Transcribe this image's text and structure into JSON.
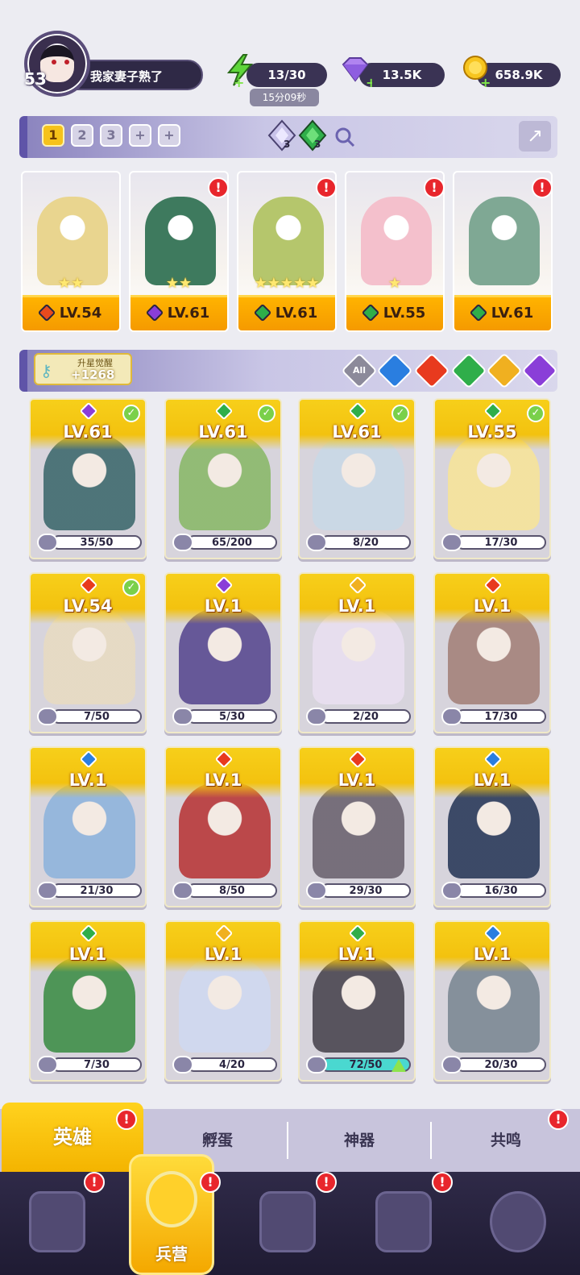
{
  "player": {
    "level": "53",
    "name": "我家妻子熟了"
  },
  "resources": {
    "energy": "13/30",
    "energy_timer": "15分09秒",
    "gems": "13.5K",
    "gold": "658.9K"
  },
  "team": {
    "tabs": [
      "1",
      "2",
      "3",
      "+",
      "+"
    ],
    "active_tab": "1",
    "counts": [
      "3",
      "3"
    ]
  },
  "team_cards": [
    {
      "level": "LV.54",
      "stars": "★★",
      "element": "fire",
      "color": "#e84a1e",
      "alert": false
    },
    {
      "level": "LV.61",
      "stars": "★★",
      "element": "dark",
      "color": "#8a3ed8",
      "alert": true
    },
    {
      "level": "LV.61",
      "stars": "★★★★★",
      "element": "nature",
      "color": "#2fae4a",
      "alert": true
    },
    {
      "level": "LV.55",
      "stars": "★",
      "element": "nature",
      "color": "#2fae4a",
      "alert": true
    },
    {
      "level": "LV.61",
      "stars": "",
      "element": "nature",
      "color": "#2fae4a",
      "alert": true
    }
  ],
  "awaken": {
    "title": "升星觉醒",
    "value": "+1268"
  },
  "filters": [
    {
      "label": "All",
      "color": "#8c8a9a"
    },
    {
      "label": "",
      "color": "#2a7ee0"
    },
    {
      "label": "",
      "color": "#e83a1e"
    },
    {
      "label": "",
      "color": "#2fae4a"
    },
    {
      "label": "",
      "color": "#f0b020"
    },
    {
      "label": "",
      "color": "#8a3ed8"
    }
  ],
  "heroes": [
    {
      "level": "LV.61",
      "progress": "35/50",
      "element_color": "#8a3ed8",
      "check": true
    },
    {
      "level": "LV.61",
      "progress": "65/200",
      "element_color": "#2fae4a",
      "check": true
    },
    {
      "level": "LV.61",
      "progress": "8/20",
      "element_color": "#2fae4a",
      "check": true
    },
    {
      "level": "LV.55",
      "progress": "17/30",
      "element_color": "#2fae4a",
      "check": true
    },
    {
      "level": "LV.54",
      "progress": "7/50",
      "element_color": "#e83a1e",
      "check": true
    },
    {
      "level": "LV.1",
      "progress": "5/30",
      "element_color": "#8a3ed8",
      "check": false
    },
    {
      "level": "LV.1",
      "progress": "2/20",
      "element_color": "#f0b020",
      "check": false
    },
    {
      "level": "LV.1",
      "progress": "17/30",
      "element_color": "#e83a1e",
      "check": false
    },
    {
      "level": "LV.1",
      "progress": "21/30",
      "element_color": "#2a7ee0",
      "check": false
    },
    {
      "level": "LV.1",
      "progress": "8/50",
      "element_color": "#e83a1e",
      "check": false
    },
    {
      "level": "LV.1",
      "progress": "29/30",
      "element_color": "#e83a1e",
      "check": false
    },
    {
      "level": "LV.1",
      "progress": "16/30",
      "element_color": "#2a7ee0",
      "check": false
    },
    {
      "level": "LV.1",
      "progress": "7/30",
      "element_color": "#2fae4a",
      "check": false
    },
    {
      "level": "LV.1",
      "progress": "4/20",
      "element_color": "#f0b020",
      "check": false
    },
    {
      "level": "LV.1",
      "progress": "72/50",
      "element_color": "#2fae4a",
      "check": false,
      "upgradable": true
    },
    {
      "level": "LV.1",
      "progress": "20/30",
      "element_color": "#2a7ee0",
      "check": false
    }
  ],
  "section_tabs": [
    "英雄",
    "孵蛋",
    "神器",
    "共鸣"
  ],
  "bottom_nav": {
    "active_label": "兵营"
  }
}
